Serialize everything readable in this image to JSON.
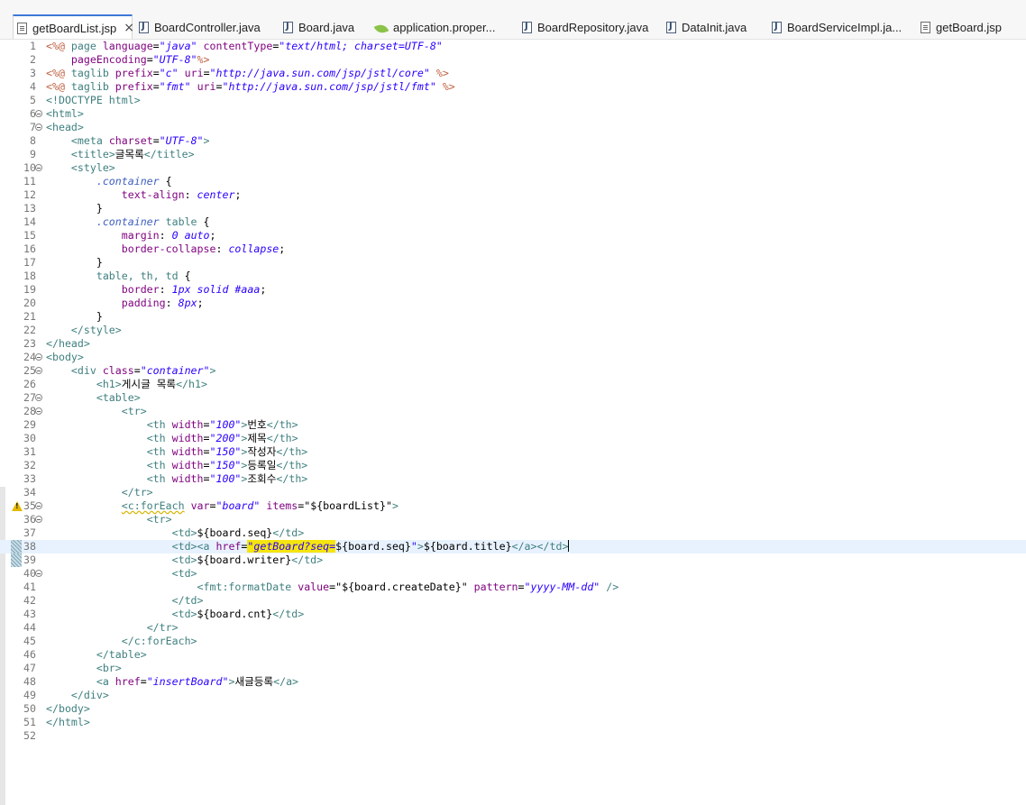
{
  "tabs": [
    {
      "label": "getBoardList.jsp",
      "icon": "jsp-file-icon",
      "active": true
    },
    {
      "label": "BoardController.java",
      "icon": "java-file-icon"
    },
    {
      "label": "Board.java",
      "icon": "java-file-icon"
    },
    {
      "label": "application.proper...",
      "icon": "spring-leaf-icon"
    },
    {
      "label": "BoardRepository.java",
      "icon": "java-file-icon"
    },
    {
      "label": "DataInit.java",
      "icon": "java-file-icon"
    },
    {
      "label": "BoardServiceImpl.ja...",
      "icon": "java-file-icon"
    },
    {
      "label": "getBoard.jsp",
      "icon": "jsp-file-icon"
    }
  ],
  "close_symbol": "×",
  "editor": {
    "current_line": 38,
    "lines": [
      {
        "n": "1",
        "fold": false,
        "segs": [
          [
            "dir",
            "<%@ "
          ],
          [
            "tag",
            "page "
          ],
          [
            "attr",
            "language"
          ],
          [
            "txt",
            "="
          ],
          [
            "str",
            "\"java\""
          ],
          [
            "txt",
            " "
          ],
          [
            "attr",
            "contentType"
          ],
          [
            "txt",
            "="
          ],
          [
            "str",
            "\"text/html; charset=UTF-8\""
          ]
        ]
      },
      {
        "n": "2",
        "segs": [
          [
            "txt",
            "    "
          ],
          [
            "attr",
            "pageEncoding"
          ],
          [
            "txt",
            "="
          ],
          [
            "str",
            "\"UTF-8\""
          ],
          [
            "dir",
            "%>"
          ]
        ]
      },
      {
        "n": "3",
        "segs": [
          [
            "dir",
            "<%@ "
          ],
          [
            "tag",
            "taglib "
          ],
          [
            "attr",
            "prefix"
          ],
          [
            "txt",
            "="
          ],
          [
            "str",
            "\"c\""
          ],
          [
            "txt",
            " "
          ],
          [
            "attr",
            "uri"
          ],
          [
            "txt",
            "="
          ],
          [
            "str",
            "\"http://java.sun.com/jsp/jstl/core\""
          ],
          [
            "txt",
            " "
          ],
          [
            "dir",
            "%>"
          ]
        ]
      },
      {
        "n": "4",
        "segs": [
          [
            "dir",
            "<%@ "
          ],
          [
            "tag",
            "taglib "
          ],
          [
            "attr",
            "prefix"
          ],
          [
            "txt",
            "="
          ],
          [
            "str",
            "\"fmt\""
          ],
          [
            "txt",
            " "
          ],
          [
            "attr",
            "uri"
          ],
          [
            "txt",
            "="
          ],
          [
            "str",
            "\"http://java.sun.com/jsp/jstl/fmt\""
          ],
          [
            "txt",
            " "
          ],
          [
            "dir",
            "%>"
          ]
        ]
      },
      {
        "n": "5",
        "segs": [
          [
            "tag",
            "<!DOCTYPE html>"
          ]
        ]
      },
      {
        "n": "6",
        "fold": true,
        "segs": [
          [
            "tag",
            "<html>"
          ]
        ]
      },
      {
        "n": "7",
        "fold": true,
        "segs": [
          [
            "tag",
            "<head>"
          ]
        ]
      },
      {
        "n": "8",
        "segs": [
          [
            "txt",
            "    "
          ],
          [
            "tag",
            "<meta "
          ],
          [
            "attr",
            "charset"
          ],
          [
            "txt",
            "="
          ],
          [
            "str",
            "\"UTF-8\""
          ],
          [
            "tag",
            ">"
          ]
        ]
      },
      {
        "n": "9",
        "segs": [
          [
            "txt",
            "    "
          ],
          [
            "tag",
            "<title>"
          ],
          [
            "txt",
            "글목록"
          ],
          [
            "tag",
            "</title>"
          ]
        ]
      },
      {
        "n": "10",
        "fold": true,
        "segs": [
          [
            "txt",
            "    "
          ],
          [
            "tag",
            "<style>"
          ]
        ]
      },
      {
        "n": "11",
        "segs": [
          [
            "txt",
            "        "
          ],
          [
            "cls",
            ".container"
          ],
          [
            "txt",
            " {"
          ]
        ]
      },
      {
        "n": "12",
        "segs": [
          [
            "txt",
            "            "
          ],
          [
            "prop",
            "text-align"
          ],
          [
            "txt",
            ": "
          ],
          [
            "val",
            "center"
          ],
          [
            "txt",
            ";"
          ]
        ]
      },
      {
        "n": "13",
        "segs": [
          [
            "txt",
            "        }"
          ]
        ]
      },
      {
        "n": "14",
        "segs": [
          [
            "txt",
            "        "
          ],
          [
            "cls",
            ".container"
          ],
          [
            "txt",
            " "
          ],
          [
            "sel",
            "table"
          ],
          [
            "txt",
            " {"
          ]
        ]
      },
      {
        "n": "15",
        "segs": [
          [
            "txt",
            "            "
          ],
          [
            "prop",
            "margin"
          ],
          [
            "txt",
            ": "
          ],
          [
            "val",
            "0 auto"
          ],
          [
            "txt",
            ";"
          ]
        ]
      },
      {
        "n": "16",
        "segs": [
          [
            "txt",
            "            "
          ],
          [
            "prop",
            "border-collapse"
          ],
          [
            "txt",
            ": "
          ],
          [
            "val",
            "collapse"
          ],
          [
            "txt",
            ";"
          ]
        ]
      },
      {
        "n": "17",
        "segs": [
          [
            "txt",
            "        }"
          ]
        ]
      },
      {
        "n": "18",
        "segs": [
          [
            "txt",
            "        "
          ],
          [
            "sel",
            "table, th, td"
          ],
          [
            "txt",
            " {"
          ]
        ]
      },
      {
        "n": "19",
        "segs": [
          [
            "txt",
            "            "
          ],
          [
            "prop",
            "border"
          ],
          [
            "txt",
            ": "
          ],
          [
            "val",
            "1px solid #aaa"
          ],
          [
            "txt",
            ";"
          ]
        ]
      },
      {
        "n": "20",
        "segs": [
          [
            "txt",
            "            "
          ],
          [
            "prop",
            "padding"
          ],
          [
            "txt",
            ": "
          ],
          [
            "val",
            "8px"
          ],
          [
            "txt",
            ";"
          ]
        ]
      },
      {
        "n": "21",
        "segs": [
          [
            "txt",
            "        }"
          ]
        ]
      },
      {
        "n": "22",
        "segs": [
          [
            "txt",
            "    "
          ],
          [
            "tag",
            "</style>"
          ]
        ]
      },
      {
        "n": "23",
        "segs": [
          [
            "tag",
            "</head>"
          ]
        ]
      },
      {
        "n": "24",
        "fold": true,
        "segs": [
          [
            "tag",
            "<body>"
          ]
        ]
      },
      {
        "n": "25",
        "fold": true,
        "segs": [
          [
            "txt",
            "    "
          ],
          [
            "tag",
            "<div "
          ],
          [
            "attr",
            "class"
          ],
          [
            "txt",
            "="
          ],
          [
            "str",
            "\"container\""
          ],
          [
            "tag",
            ">"
          ]
        ]
      },
      {
        "n": "26",
        "segs": [
          [
            "txt",
            "        "
          ],
          [
            "tag",
            "<h1>"
          ],
          [
            "txt",
            "게시글 목록"
          ],
          [
            "tag",
            "</h1>"
          ]
        ]
      },
      {
        "n": "27",
        "fold": true,
        "segs": [
          [
            "txt",
            "        "
          ],
          [
            "tag",
            "<table>"
          ]
        ]
      },
      {
        "n": "28",
        "fold": true,
        "segs": [
          [
            "txt",
            "            "
          ],
          [
            "tag",
            "<tr>"
          ]
        ]
      },
      {
        "n": "29",
        "segs": [
          [
            "txt",
            "                "
          ],
          [
            "tag",
            "<th "
          ],
          [
            "attr",
            "width"
          ],
          [
            "txt",
            "="
          ],
          [
            "str",
            "\"100\""
          ],
          [
            "tag",
            ">"
          ],
          [
            "txt",
            "번호"
          ],
          [
            "tag",
            "</th>"
          ]
        ]
      },
      {
        "n": "30",
        "segs": [
          [
            "txt",
            "                "
          ],
          [
            "tag",
            "<th "
          ],
          [
            "attr",
            "width"
          ],
          [
            "txt",
            "="
          ],
          [
            "str",
            "\"200\""
          ],
          [
            "tag",
            ">"
          ],
          [
            "txt",
            "제목"
          ],
          [
            "tag",
            "</th>"
          ]
        ]
      },
      {
        "n": "31",
        "segs": [
          [
            "txt",
            "                "
          ],
          [
            "tag",
            "<th "
          ],
          [
            "attr",
            "width"
          ],
          [
            "txt",
            "="
          ],
          [
            "str",
            "\"150\""
          ],
          [
            "tag",
            ">"
          ],
          [
            "txt",
            "작성자"
          ],
          [
            "tag",
            "</th>"
          ]
        ]
      },
      {
        "n": "32",
        "segs": [
          [
            "txt",
            "                "
          ],
          [
            "tag",
            "<th "
          ],
          [
            "attr",
            "width"
          ],
          [
            "txt",
            "="
          ],
          [
            "str",
            "\"150\""
          ],
          [
            "tag",
            ">"
          ],
          [
            "txt",
            "등록일"
          ],
          [
            "tag",
            "</th>"
          ]
        ]
      },
      {
        "n": "33",
        "segs": [
          [
            "txt",
            "                "
          ],
          [
            "tag",
            "<th "
          ],
          [
            "attr",
            "width"
          ],
          [
            "txt",
            "="
          ],
          [
            "str",
            "\"100\""
          ],
          [
            "tag",
            ">"
          ],
          [
            "txt",
            "조회수"
          ],
          [
            "tag",
            "</th>"
          ]
        ]
      },
      {
        "n": "34",
        "segs": [
          [
            "txt",
            "            "
          ],
          [
            "tag",
            "</tr>"
          ]
        ]
      },
      {
        "n": "35",
        "fold": true,
        "warn": true,
        "segs": [
          [
            "txt",
            "            "
          ],
          [
            "tagu",
            "<c:forEach"
          ],
          [
            "txt",
            " "
          ],
          [
            "attr",
            "var"
          ],
          [
            "txt",
            "="
          ],
          [
            "str",
            "\"board\""
          ],
          [
            "txt",
            " "
          ],
          [
            "attr",
            "items"
          ],
          [
            "txt",
            "=\"${boardList}\""
          ],
          [
            "tag",
            ">"
          ]
        ]
      },
      {
        "n": "36",
        "fold": true,
        "segs": [
          [
            "txt",
            "                "
          ],
          [
            "tag",
            "<tr>"
          ]
        ]
      },
      {
        "n": "37",
        "segs": [
          [
            "txt",
            "                    "
          ],
          [
            "tag",
            "<td>"
          ],
          [
            "txt",
            "${board.seq}"
          ],
          [
            "tag",
            "</td>"
          ]
        ]
      },
      {
        "n": "38",
        "qd": true,
        "segs": [
          [
            "txt",
            "                    "
          ],
          [
            "tag",
            "<td><a "
          ],
          [
            "attr",
            "href"
          ],
          [
            "txt",
            "="
          ],
          [
            "strhl",
            "\"getBoard?seq="
          ],
          [
            "txt",
            "${board.seq}"
          ],
          [
            "str",
            "\""
          ],
          [
            "tag",
            ">"
          ],
          [
            "txt",
            "${board.title}"
          ],
          [
            "tag",
            "</a>"
          ],
          [
            "tag",
            "<"
          ],
          [
            "tag",
            "/td>"
          ],
          [
            "caret",
            ""
          ]
        ]
      },
      {
        "n": "39",
        "qd": true,
        "segs": [
          [
            "txt",
            "                    "
          ],
          [
            "tag",
            "<td>"
          ],
          [
            "txt",
            "${board.writer}"
          ],
          [
            "tag",
            "</td>"
          ]
        ]
      },
      {
        "n": "40",
        "fold": true,
        "segs": [
          [
            "txt",
            "                    "
          ],
          [
            "tag",
            "<td>"
          ]
        ]
      },
      {
        "n": "41",
        "segs": [
          [
            "txt",
            "                        "
          ],
          [
            "tag",
            "<fmt:formatDate "
          ],
          [
            "attr",
            "value"
          ],
          [
            "txt",
            "=\"${board.createDate}\" "
          ],
          [
            "attr",
            "pattern"
          ],
          [
            "txt",
            "="
          ],
          [
            "str",
            "\"yyyy-MM-dd\""
          ],
          [
            "txt",
            " "
          ],
          [
            "tag",
            "/>"
          ]
        ]
      },
      {
        "n": "42",
        "segs": [
          [
            "txt",
            "                    "
          ],
          [
            "tag",
            "</td>"
          ]
        ]
      },
      {
        "n": "43",
        "segs": [
          [
            "txt",
            "                    "
          ],
          [
            "tag",
            "<td>"
          ],
          [
            "txt",
            "${board.cnt}"
          ],
          [
            "tag",
            "</td>"
          ]
        ]
      },
      {
        "n": "44",
        "segs": [
          [
            "txt",
            "                "
          ],
          [
            "tag",
            "</tr>"
          ]
        ]
      },
      {
        "n": "45",
        "segs": [
          [
            "txt",
            "            "
          ],
          [
            "tag",
            "</c:forEach>"
          ]
        ]
      },
      {
        "n": "46",
        "segs": [
          [
            "txt",
            "        "
          ],
          [
            "tag",
            "</table>"
          ]
        ]
      },
      {
        "n": "47",
        "segs": [
          [
            "txt",
            "        "
          ],
          [
            "tag",
            "<br>"
          ]
        ]
      },
      {
        "n": "48",
        "segs": [
          [
            "txt",
            "        "
          ],
          [
            "tag",
            "<a "
          ],
          [
            "attr",
            "href"
          ],
          [
            "txt",
            "="
          ],
          [
            "str",
            "\"insertBoard\""
          ],
          [
            "tag",
            ">"
          ],
          [
            "txt",
            "새글등록"
          ],
          [
            "tag",
            "</a>"
          ]
        ]
      },
      {
        "n": "49",
        "segs": [
          [
            "txt",
            "    "
          ],
          [
            "tag",
            "</div>"
          ]
        ]
      },
      {
        "n": "50",
        "segs": [
          [
            "tag",
            "</body>"
          ]
        ]
      },
      {
        "n": "51",
        "segs": [
          [
            "tag",
            "</html>"
          ]
        ]
      },
      {
        "n": "52",
        "segs": []
      }
    ]
  }
}
